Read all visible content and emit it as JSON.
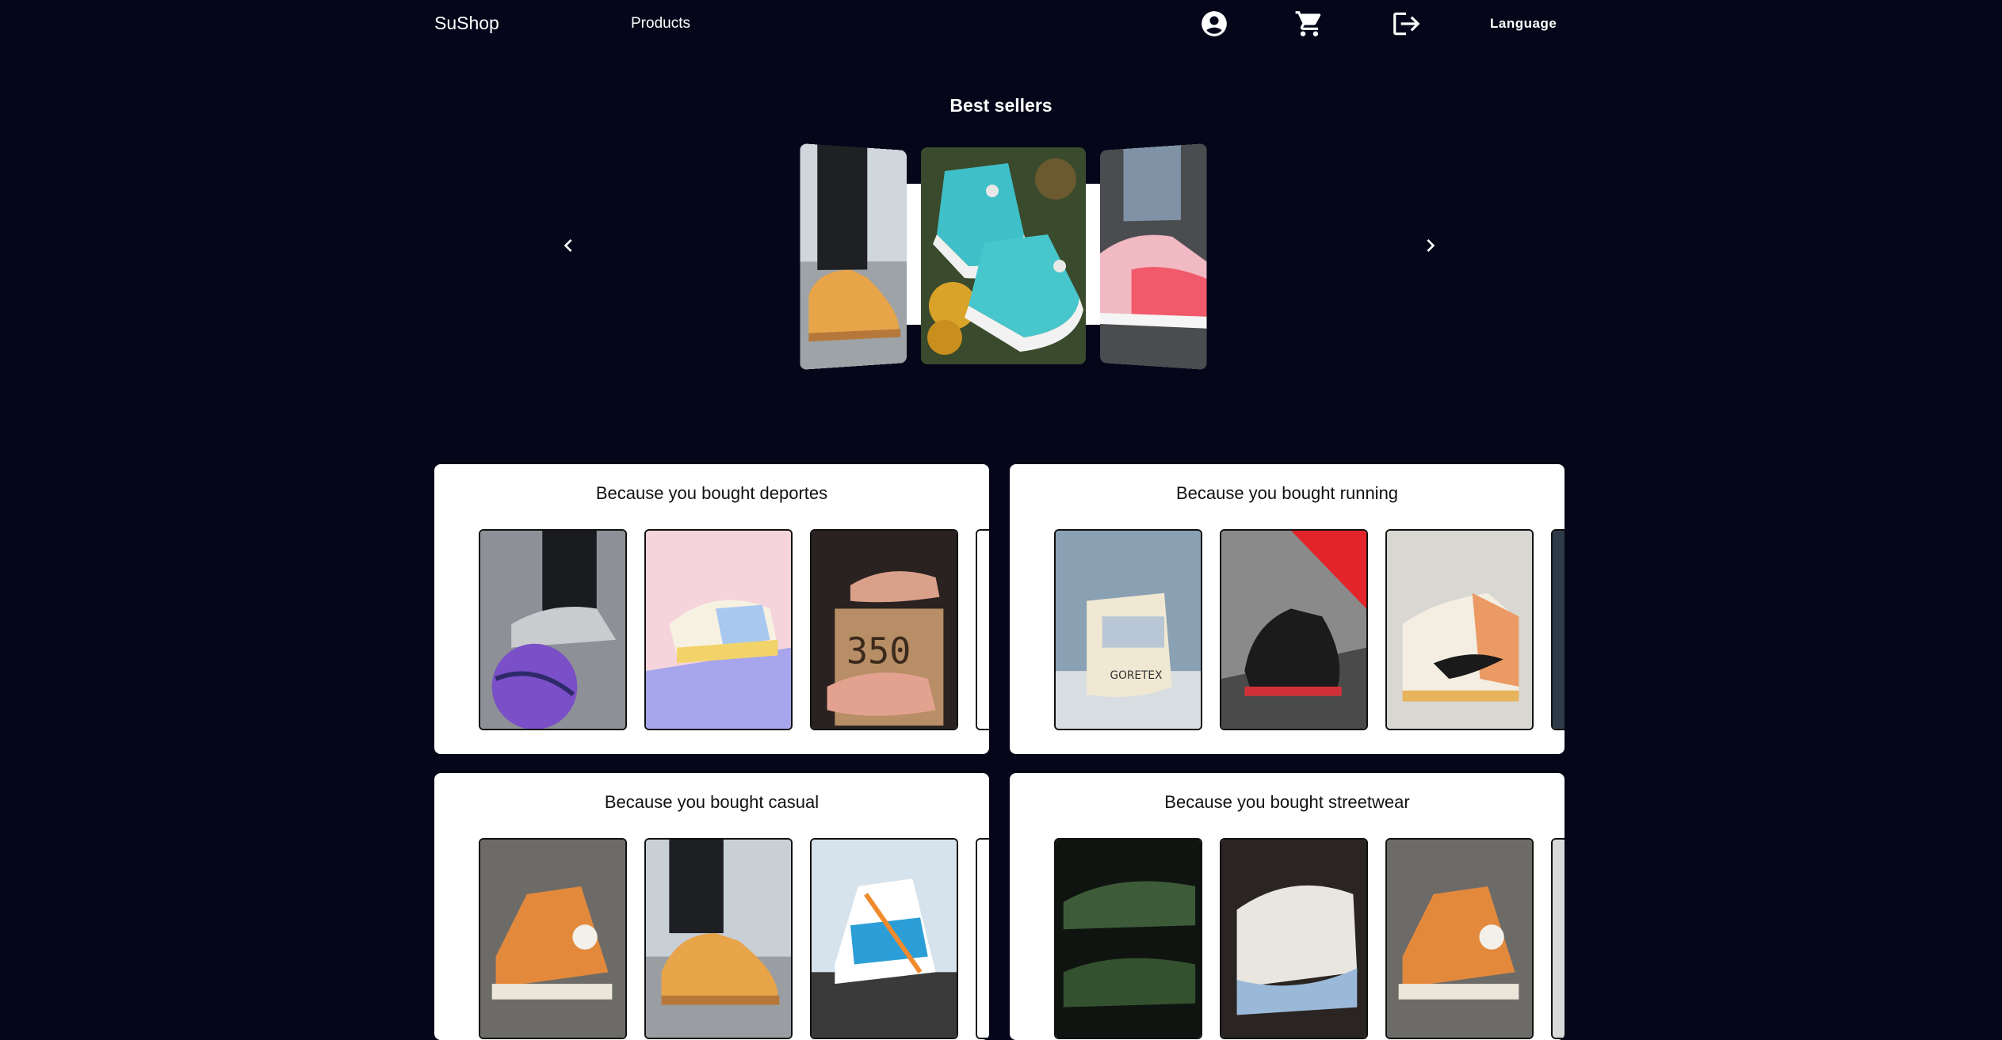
{
  "header": {
    "brand": "SuShop",
    "nav_products": "Products",
    "icons": [
      "account-circle-icon",
      "shopping-cart-icon",
      "logout-icon"
    ],
    "language_label": "Language"
  },
  "best_sellers": {
    "title": "Best sellers",
    "slides": [
      "wheat-boot",
      "teal-high-top",
      "pink-runner"
    ]
  },
  "recommendations": [
    {
      "title": "Because you bought deportes",
      "items": [
        "grey-sneaker-basketball",
        "pastel-sneaker",
        "peach-knit-sneaker",
        "partial-item"
      ]
    },
    {
      "title": "Because you bought running",
      "items": [
        "goretex-boot",
        "black-red-sneaker",
        "orange-high-top",
        "partial-item"
      ]
    },
    {
      "title": "Because you bought casual",
      "items": [
        "orange-high-top",
        "wheat-boot",
        "blue-orange-high-top",
        "partial-item"
      ]
    },
    {
      "title": "Because you bought streetwear",
      "items": [
        "green-slip-on",
        "white-runner",
        "orange-high-top",
        "partial-item"
      ]
    }
  ],
  "colors": {
    "background": "#05061a",
    "card": "#ffffff",
    "text_dark": "#111111"
  }
}
